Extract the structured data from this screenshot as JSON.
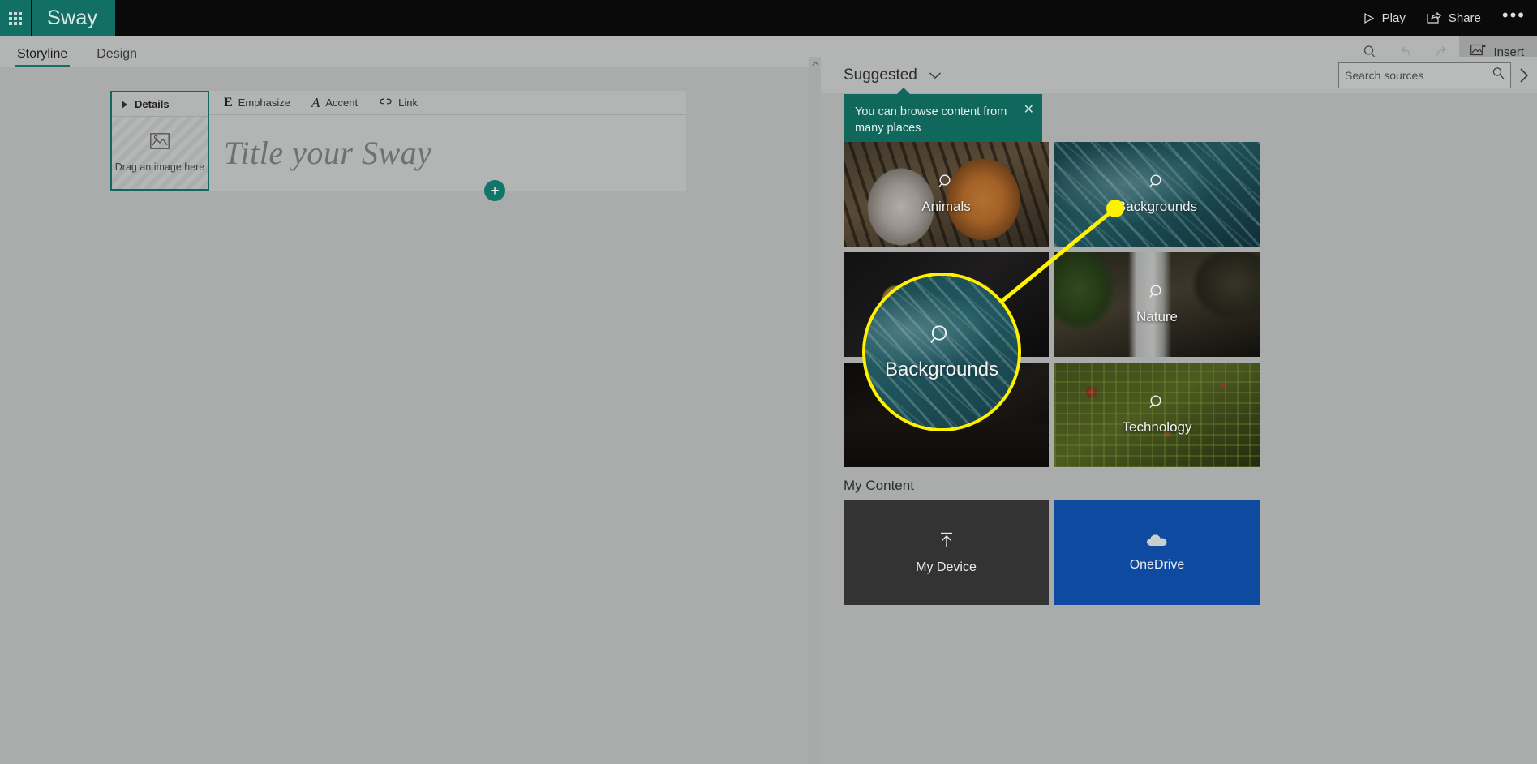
{
  "topbar": {
    "waffle_label": "app-launcher",
    "brand": "Sway",
    "play": "Play",
    "share": "Share",
    "more": "•••"
  },
  "ribbon": {
    "tabs": [
      {
        "label": "Storyline",
        "active": true
      },
      {
        "label": "Design",
        "active": false
      }
    ],
    "search_icon": "search-icon",
    "undo_icon": "undo-icon",
    "redo_icon": "redo-icon",
    "insert_label": "Insert"
  },
  "canvas": {
    "details": {
      "title": "Details",
      "drop_label": "Drag an image here"
    },
    "title_card": {
      "toolbar": [
        {
          "glyph": "E",
          "label": "Emphasize"
        },
        {
          "glyph": "A",
          "label": "Accent"
        },
        {
          "glyph": "link",
          "label": "Link"
        }
      ],
      "placeholder": "Title your Sway"
    },
    "add_card_label": "+"
  },
  "panel": {
    "source_label": "Suggested",
    "search": {
      "placeholder": "Search sources",
      "value": ""
    },
    "expand_label": "›",
    "tooltip": {
      "text": "You can browse content from many places",
      "close": "✕"
    },
    "tiles": [
      {
        "label": "Animals",
        "art": "art-animals"
      },
      {
        "label": "Backgrounds",
        "art": "art-backgrounds"
      },
      {
        "label": "",
        "art": "art-food"
      },
      {
        "label": "Nature",
        "art": "art-nature"
      },
      {
        "label": "",
        "art": "art-desk"
      },
      {
        "label": "Technology",
        "art": "art-tech"
      }
    ],
    "my_content": {
      "title": "My Content",
      "items": [
        {
          "label": "My Device",
          "icon": "upload-icon"
        },
        {
          "label": "OneDrive",
          "icon": "cloud-icon"
        }
      ]
    }
  },
  "annotation": {
    "magnified_label": "Backgrounds",
    "highlight_color": "#fff200"
  },
  "colors": {
    "brand_teal": "#116f63",
    "tooltip_teal": "#10685d",
    "onedrive_blue": "#0f4aa1",
    "device_gray": "#333333",
    "chrome_gray": "#aaabab",
    "topbar_black": "#0a0a0a"
  }
}
